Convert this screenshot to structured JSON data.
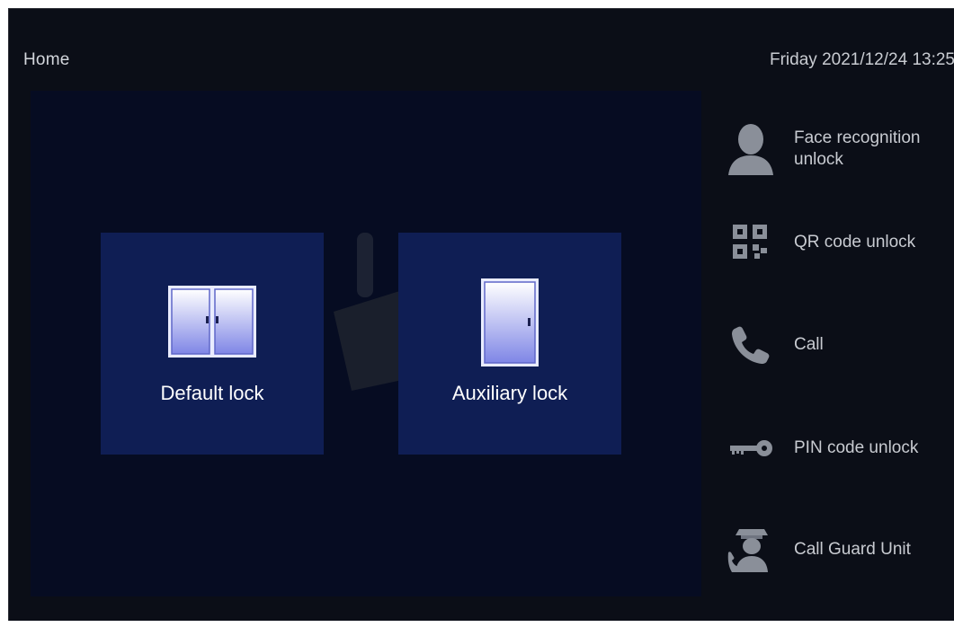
{
  "header": {
    "title": "Home",
    "datetime": "Friday 2021/12/24 13:25"
  },
  "locks": [
    {
      "label": "Default lock",
      "icon": "double-door-icon"
    },
    {
      "label": "Auxiliary lock",
      "icon": "single-door-icon"
    }
  ],
  "side_menu": [
    {
      "label_line1": "Face recognition",
      "label_line2": "unlock",
      "icon": "face-icon"
    },
    {
      "label_line1": "QR code unlock",
      "label_line2": "",
      "icon": "qr-code-icon"
    },
    {
      "label_line1": "Call",
      "label_line2": "",
      "icon": "phone-icon"
    },
    {
      "label_line1": "PIN code unlock",
      "label_line2": "",
      "icon": "key-icon"
    },
    {
      "label_line1": "Call Guard Unit",
      "label_line2": "",
      "icon": "guard-icon"
    }
  ],
  "colors": {
    "background": "#0b0e17",
    "panel": "#060c22",
    "tile": "#0f1e54",
    "text": "#c8cbd1"
  }
}
